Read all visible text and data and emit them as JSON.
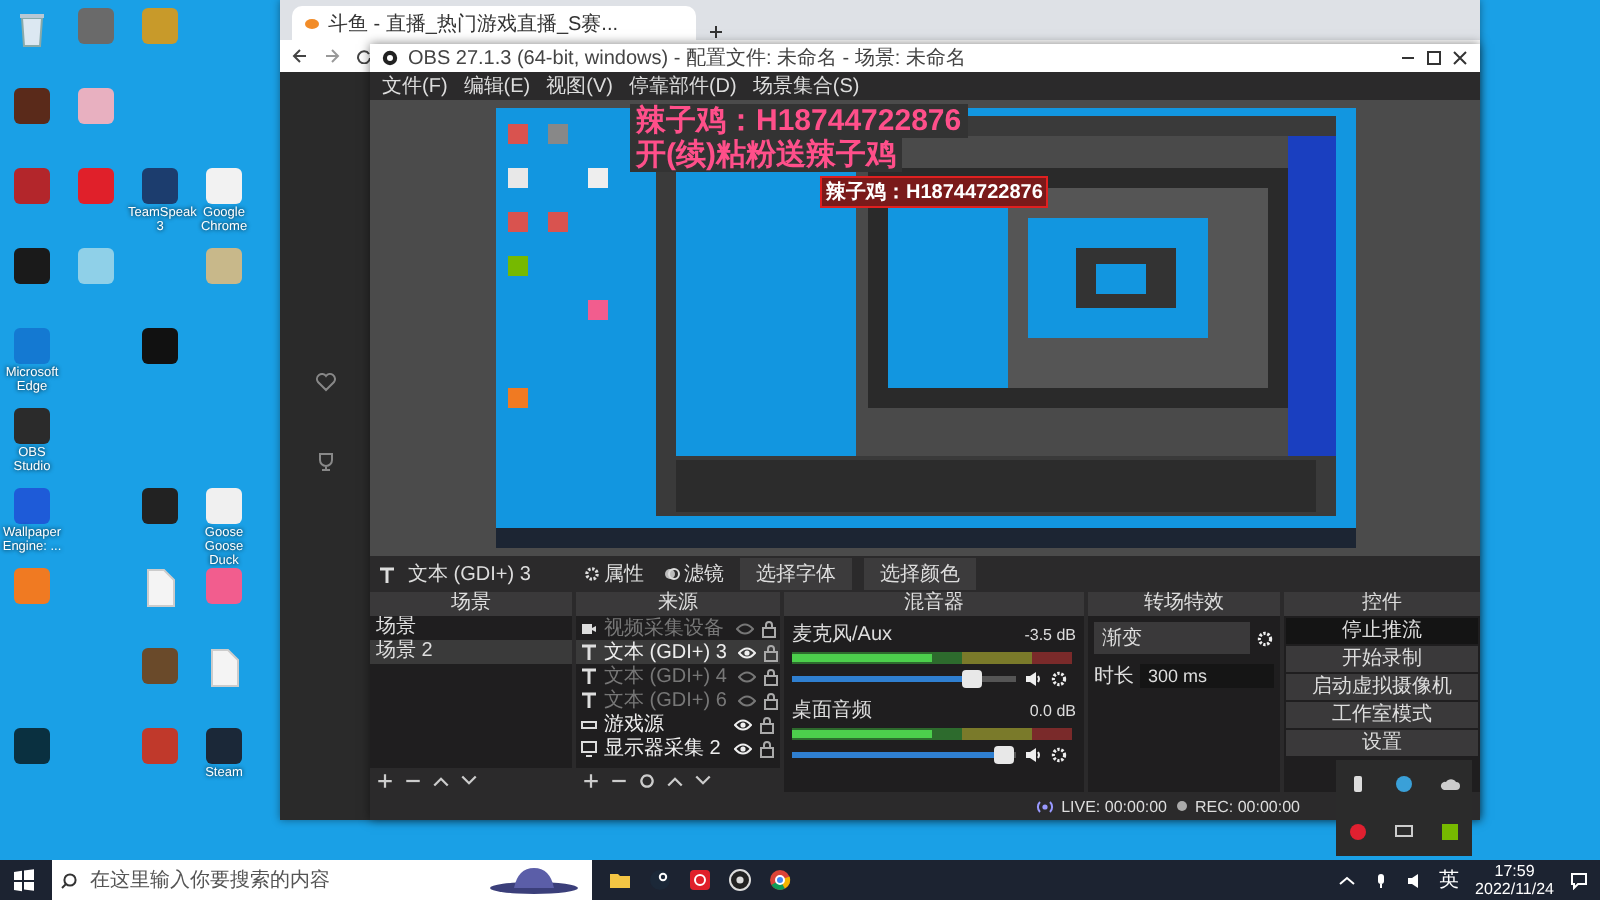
{
  "desktop": {
    "columns": [
      [
        {
          "kind": "bin"
        },
        {
          "kind": "app",
          "color": "#5a2a1a"
        },
        {
          "kind": "app",
          "color": "#b3262b"
        },
        {
          "kind": "app",
          "color": "#1a1a1a"
        },
        {
          "kind": "app",
          "color": "#1479d2",
          "label": "Microsoft Edge"
        },
        {
          "kind": "app",
          "color": "#2b2b2b",
          "label": "OBS Studio"
        },
        {
          "kind": "app",
          "color": "#1e5bd8",
          "label": "Wallpaper Engine: ..."
        },
        {
          "kind": "app",
          "color": "#f07a22"
        },
        {
          "kind": "empty"
        },
        {
          "kind": "app",
          "color": "#0a3040"
        }
      ],
      [
        {
          "kind": "app",
          "color": "#6a6a6a"
        },
        {
          "kind": "app",
          "color": "#e8b0c0"
        },
        {
          "kind": "app",
          "color": "#e0202a"
        },
        {
          "kind": "app",
          "color": "#8fd0e8"
        },
        {
          "kind": "empty"
        },
        {
          "kind": "empty"
        },
        {
          "kind": "empty"
        },
        {
          "kind": "empty"
        },
        {
          "kind": "empty"
        },
        {
          "kind": "empty"
        }
      ],
      [
        {
          "kind": "app",
          "color": "#c89a2a"
        },
        {
          "kind": "empty"
        },
        {
          "kind": "app",
          "color": "#1c3d6e",
          "label": "TeamSpeak 3"
        },
        {
          "kind": "empty"
        },
        {
          "kind": "app",
          "color": "#111111"
        },
        {
          "kind": "empty"
        },
        {
          "kind": "app",
          "color": "#222222"
        },
        {
          "kind": "file"
        },
        {
          "kind": "app",
          "color": "#6a4a2a"
        },
        {
          "kind": "app",
          "color": "#c0392b"
        }
      ],
      [
        {
          "kind": "empty"
        },
        {
          "kind": "empty"
        },
        {
          "kind": "app",
          "color": "#f2f2f2",
          "label": "Google Chrome"
        },
        {
          "kind": "app",
          "color": "#c8b88a"
        },
        {
          "kind": "empty"
        },
        {
          "kind": "empty"
        },
        {
          "kind": "app",
          "color": "#f0f0f0",
          "label": "Goose Goose Duck"
        },
        {
          "kind": "app",
          "color": "#f25d8e"
        },
        {
          "kind": "file"
        },
        {
          "kind": "app",
          "color": "#1b2838",
          "label": "Steam"
        }
      ]
    ]
  },
  "browser": {
    "tab": "斗鱼 - 直播_热门游戏直播_S赛..."
  },
  "obs": {
    "title": "OBS 27.1.3 (64-bit, windows) - 配置文件: 未命名 - 场景: 未命名",
    "menu": [
      "文件(F)",
      "编辑(E)",
      "视图(V)",
      "停靠部件(D)",
      "场景集合(S)"
    ],
    "overlays": [
      {
        "kind": "big",
        "text": "辣子鸡：H18744722876"
      },
      {
        "kind": "big",
        "text": "开(续)粘粉送辣子鸡"
      },
      {
        "kind": "selected",
        "text": "辣子鸡：H18744722876"
      }
    ],
    "source_toolbar": {
      "source": "文本 (GDI+) 3",
      "properties": "属性",
      "filters": "滤镜",
      "buttons": [
        "选择字体",
        "选择颜色"
      ]
    },
    "docks": {
      "scenes_title": "场景",
      "sources_title": "来源",
      "mixer_title": "混音器",
      "transitions_title": "转场特效",
      "controls_title": "控件"
    },
    "scenes": [
      {
        "name": "场景",
        "selected": false
      },
      {
        "name": "场景 2",
        "selected": true
      }
    ],
    "sources": [
      {
        "kind": "camera",
        "name": "视频采集设备",
        "visible": false,
        "selected": false
      },
      {
        "kind": "text",
        "name": "文本 (GDI+) 3",
        "visible": true,
        "selected": true
      },
      {
        "kind": "text",
        "name": "文本 (GDI+) 4",
        "visible": false,
        "selected": false
      },
      {
        "kind": "text",
        "name": "文本 (GDI+) 6",
        "visible": false,
        "selected": false
      },
      {
        "kind": "game",
        "name": "游戏源",
        "visible": true,
        "selected": false
      },
      {
        "kind": "monitor",
        "name": "显示器采集 2",
        "visible": true,
        "selected": false
      }
    ],
    "mixer": [
      {
        "name": "麦克风/Aux",
        "reading": "-3.5 dB",
        "level": 0.8
      },
      {
        "name": "桌面音频",
        "reading": "0.0 dB",
        "level": 0.95
      }
    ],
    "transition": {
      "value": "渐变",
      "duration_label": "时长",
      "duration": "300 ms"
    },
    "controls": [
      {
        "label": "停止推流",
        "checked": true
      },
      {
        "label": "开始录制",
        "checked": false
      },
      {
        "label": "启动虚拟摄像机",
        "checked": false
      },
      {
        "label": "工作室模式",
        "checked": false
      },
      {
        "label": "设置",
        "checked": false
      }
    ],
    "status": {
      "live": "LIVE: 00:00:00",
      "rec": "REC: 00:00:00"
    }
  },
  "taskbar": {
    "search_placeholder": "在这里输入你要搜索的内容",
    "ime": "英",
    "time": "17:59",
    "date": "2022/11/24"
  }
}
